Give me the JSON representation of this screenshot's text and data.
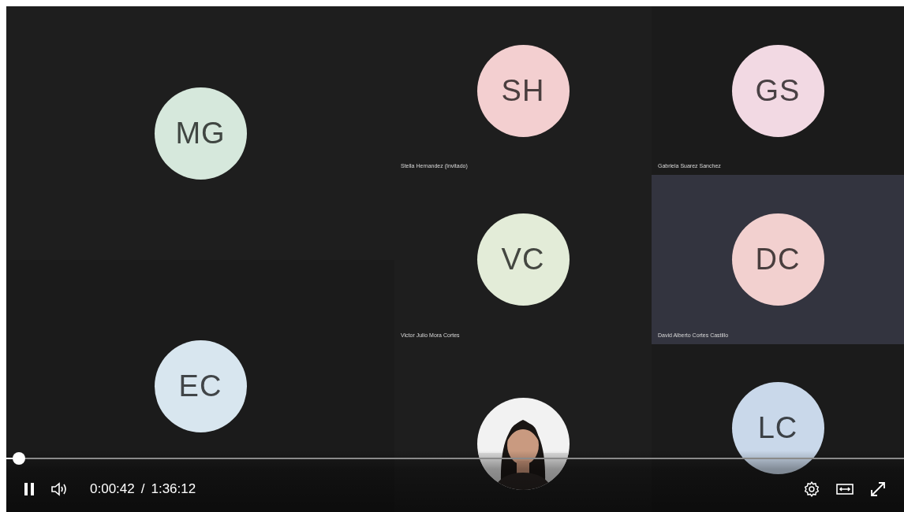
{
  "tiles": [
    {
      "kind": "avatar",
      "initials": "MG",
      "color": "#d6e8dc",
      "active": false
    },
    {
      "kind": "avatar",
      "initials": "EC",
      "color": "#d8e6ef",
      "active": false
    },
    {
      "kind": "avatar",
      "initials": "SH",
      "color": "#f3cfd0",
      "active": false,
      "name": "Stella Hernandez (Invitado)"
    },
    {
      "kind": "avatar",
      "initials": "GS",
      "color": "#f2d9e3",
      "active": false,
      "name": "Gabriela Suarez Sanchez"
    },
    {
      "kind": "avatar",
      "initials": "VC",
      "color": "#e3ecd8",
      "active": false,
      "name": "Victor Julio Mora Cortes"
    },
    {
      "kind": "avatar",
      "initials": "DC",
      "color": "#f2d0cf",
      "active": true,
      "name": "David Alberto Cortes Castillo"
    },
    {
      "kind": "picture",
      "active": false
    },
    {
      "kind": "avatar",
      "initials": "LC",
      "color": "#c9d8ea",
      "active": false
    }
  ],
  "player": {
    "playing": true,
    "level": 0.007,
    "current_time": "0:00:42",
    "separator": "/",
    "duration": "1:36:12"
  }
}
